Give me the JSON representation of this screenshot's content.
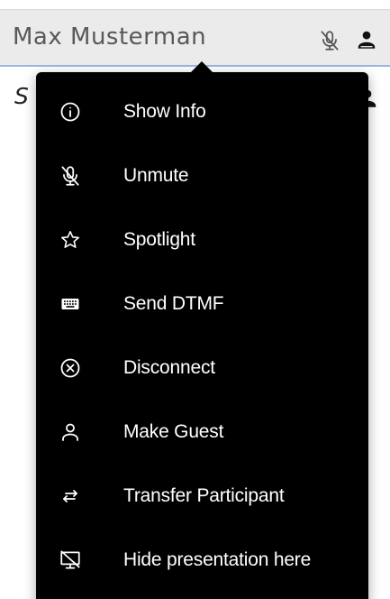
{
  "participant": {
    "name": "Max Musterman",
    "icons": [
      "mic-muted-icon",
      "person-icon"
    ]
  },
  "second_row": {
    "name_fragment": "S"
  },
  "menu": {
    "items": [
      {
        "label": "Show Info",
        "icon": "info-icon"
      },
      {
        "label": "Unmute",
        "icon": "mic-muted-icon"
      },
      {
        "label": "Spotlight",
        "icon": "star-icon"
      },
      {
        "label": "Send DTMF",
        "icon": "keyboard-icon"
      },
      {
        "label": "Disconnect",
        "icon": "close-circle-icon"
      },
      {
        "label": "Make Guest",
        "icon": "person-outline-icon"
      },
      {
        "label": "Transfer Participant",
        "icon": "transfer-icon"
      },
      {
        "label": "Hide presentation here",
        "icon": "hide-presentation-icon"
      }
    ]
  },
  "colors": {
    "menu_background": "#000000",
    "menu_text": "#ffffff",
    "row_background": "#ebebeb",
    "row_underline": "#9bb6e0"
  }
}
